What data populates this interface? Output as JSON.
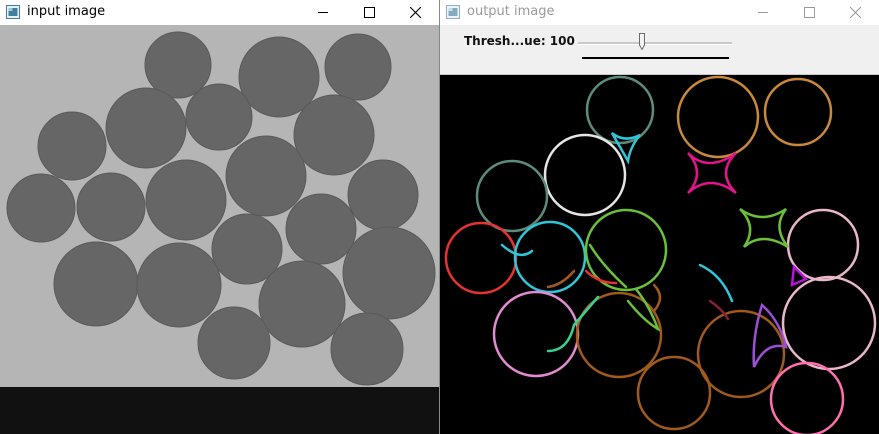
{
  "windows": {
    "input": {
      "title": "input image",
      "icon": "app-window-icon",
      "controls": [
        "minimize-icon",
        "maximize-icon",
        "close-icon"
      ]
    },
    "output": {
      "title": "output image",
      "icon": "app-window-icon",
      "controls": [
        "minimize-icon",
        "maximize-icon",
        "close-icon"
      ]
    }
  },
  "trackbar": {
    "label": "Thresh...ue: 100",
    "value": 100,
    "position_fraction": 0.42
  },
  "colors": {
    "input_background": "#b5b5b5",
    "disc_fill": "#666666",
    "output_background": "#000000",
    "contour_colors": [
      "#5e8c7a",
      "#c9893a",
      "#e0148b",
      "#6bbf3a",
      "#e5e5e5",
      "#e63232",
      "#2fc6d9",
      "#a05a1c",
      "#e38ad1",
      "#9b4fd4",
      "#ff6fb0",
      "#b316d6",
      "#e8b7c9",
      "#8a1f3a",
      "#37d38c"
    ]
  }
}
